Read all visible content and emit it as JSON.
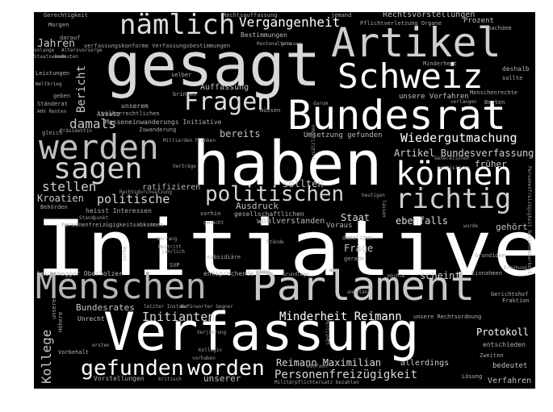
{
  "words": [
    {
      "text": "Initiative",
      "shade": "#ffffff"
    },
    {
      "text": "haben",
      "shade": "#ffffff"
    },
    {
      "text": "gesagt",
      "shade": "#d8d8d8"
    },
    {
      "text": "Verfassung",
      "shade": "#ffffff"
    },
    {
      "text": "Parlament",
      "shade": "#c8c8c8"
    },
    {
      "text": "Menschen",
      "shade": "#b5b5b5"
    },
    {
      "text": "Bundesrat",
      "shade": "#ffffff"
    },
    {
      "text": "Artikel",
      "shade": "#cfcfcf"
    },
    {
      "text": "Schweiz",
      "shade": "#ffffff"
    },
    {
      "text": "nämlich",
      "shade": "#dcdcdc"
    },
    {
      "text": "werden",
      "shade": "#c0c0c0"
    },
    {
      "text": "können",
      "shade": "#ffffff"
    },
    {
      "text": "sagen",
      "shade": "#d0d0d0"
    },
    {
      "text": "Fragen",
      "shade": "#dedede"
    },
    {
      "text": "richtig",
      "shade": "#d0d0d0"
    },
    {
      "text": "politischen",
      "shade": "#d4d4d4"
    },
    {
      "text": "gefunden",
      "shade": "#ffffff"
    },
    {
      "text": "worden",
      "shade": "#ffffff"
    },
    {
      "text": "Vergangenheit",
      "shade": "#ffffff"
    },
    {
      "text": "Wiedergutmachung",
      "shade": "#ffffff"
    },
    {
      "text": "Minderheit Reimann",
      "shade": "#ffffff"
    },
    {
      "text": "Personenfreizügigkeit",
      "shade": "#d8d8d8"
    },
    {
      "text": "Reimann Maximilian",
      "shade": "#d8d8d8"
    },
    {
      "text": "Initianten",
      "shade": "#d8d8d8"
    },
    {
      "text": "Kollege",
      "shade": "#c8c8c8"
    },
    {
      "text": "politische",
      "shade": "#d8d8d8"
    },
    {
      "text": "stellen",
      "shade": "#d0d0d0"
    },
    {
      "text": "damals",
      "shade": "#c8c8c8"
    },
    {
      "text": "Bericht",
      "shade": "#c8c8c8"
    },
    {
      "text": "Jahren",
      "shade": "#c8c8c8"
    },
    {
      "text": "Artikel Bundesverfassung",
      "shade": "#d0d0d0"
    },
    {
      "text": "früher",
      "shade": "#d0d0d0"
    },
    {
      "text": "bereits",
      "shade": "#c0c0c0"
    },
    {
      "text": "sollten",
      "shade": "#c8c8c8"
    },
    {
      "text": "ebenfalls",
      "shade": "#d8d8d8"
    },
    {
      "text": "Staat",
      "shade": "#d8d8d8"
    },
    {
      "text": "Frage",
      "shade": "#c8c8c8"
    },
    {
      "text": "scheint",
      "shade": "#d0d0d0"
    },
    {
      "text": "Protokoll",
      "shade": "#ffffff"
    },
    {
      "text": "allerdings",
      "shade": "#c8c8c8"
    },
    {
      "text": "Verfahren",
      "shade": "#c0c0c0"
    },
    {
      "text": "bedeutet",
      "shade": "#c0c0c0"
    },
    {
      "text": "Bundesrates",
      "shade": "#c8c8c8"
    },
    {
      "text": "Kroatien",
      "shade": "#c8c8c8"
    },
    {
      "text": "Auffassung",
      "shade": "#c0c0c0"
    },
    {
      "text": "unsere Vorfahren",
      "shade": "#c0c0c0"
    },
    {
      "text": "Rechtsvorstellungen",
      "shade": "#c0c0c0"
    },
    {
      "text": "Prozent",
      "shade": "#c0c0c0"
    },
    {
      "text": "Bestimmungen",
      "shade": "#b8b8b8"
    },
    {
      "text": "Leutenegger Oberholzer",
      "shade": "#b8b8b8"
    },
    {
      "text": "entsprechende",
      "shade": "#b0b0b0"
    },
    {
      "text": "gehört",
      "shade": "#c0c0c0"
    },
    {
      "text": "unserer",
      "shade": "#c0c0c0"
    },
    {
      "text": "Unrecht",
      "shade": "#c0c0c0"
    },
    {
      "text": "Absatz",
      "shade": "#b8b8b8"
    },
    {
      "text": "unserem",
      "shade": "#b8b8b8"
    },
    {
      "text": "Umsetzung gefunden",
      "shade": "#b8b8b8"
    },
    {
      "text": "Ausdruck",
      "shade": "#c0c0c0"
    },
    {
      "text": "ratifizieren",
      "shade": "#b8b8b8"
    },
    {
      "text": "gesellschaftlichen",
      "shade": "#b0b0b0"
    },
    {
      "text": "Voraus",
      "shade": "#b8b8b8"
    },
    {
      "text": "wohlverstanden",
      "shade": "#b8b8b8"
    },
    {
      "text": "Entscheidung",
      "shade": "#b0b0b0"
    },
    {
      "text": "Gerechtigkeit",
      "shade": "#b0b0b0"
    },
    {
      "text": "Rechtsauffassung",
      "shade": "#a8a8a8"
    },
    {
      "text": "jemand",
      "shade": "#a8a8a8"
    },
    {
      "text": "Pflichtverletzung Organe",
      "shade": "#a8a8a8"
    },
    {
      "text": "nachdem",
      "shade": "#a8a8a8"
    },
    {
      "text": "Morgen",
      "shade": "#b0b0b0"
    },
    {
      "text": "darauf",
      "shade": "#b0b0b0"
    },
    {
      "text": "verfassungskonforme Verfassungsbestimmungen",
      "shade": "#a8a8a8"
    },
    {
      "text": "solange",
      "shade": "#a8a8a8"
    },
    {
      "text": "Altersvorsorge",
      "shade": "#a8a8a8"
    },
    {
      "text": "Staatswesen",
      "shade": "#a0a0a0"
    },
    {
      "text": "bedeuten",
      "shade": "#a8a8a8"
    },
    {
      "text": "Rentenalters",
      "shade": "#a0a0a0"
    },
    {
      "text": "grossen",
      "shade": "#a0a0a0"
    },
    {
      "text": "Minderheit",
      "shade": "#a8a8a8"
    },
    {
      "text": "deshalb",
      "shade": "#b0b0b0"
    },
    {
      "text": "sollte",
      "shade": "#b0b0b0"
    },
    {
      "text": "Leistungen",
      "shade": "#b0b0b0"
    },
    {
      "text": "selber",
      "shade": "#b0b0b0"
    },
    {
      "text": "Weltkrieg",
      "shade": "#a8a8a8"
    },
    {
      "text": "geben",
      "shade": "#a8a8a8"
    },
    {
      "text": "bringen",
      "shade": "#a8a8a8"
    },
    {
      "text": "Menschenrechte",
      "shade": "#a8a8a8"
    },
    {
      "text": "Ständerat",
      "shade": "#b0b0b0"
    },
    {
      "text": "AHV Renten",
      "shade": "#a8a8a8"
    },
    {
      "text": "völkerrechtlichen",
      "shade": "#a8a8a8"
    },
    {
      "text": "Masseneinwanderungs Initiative",
      "shade": "#b0b0b0"
    },
    {
      "text": "müssen",
      "shade": "#a8a8a8"
    },
    {
      "text": "darum",
      "shade": "#a0a0a0"
    },
    {
      "text": "verlangen",
      "shade": "#a0a0a0"
    },
    {
      "text": "Besten",
      "shade": "#a8a8a8"
    },
    {
      "text": "gleich",
      "shade": "#a8a8a8"
    },
    {
      "text": "Präsidentin",
      "shade": "#a8a8a8"
    },
    {
      "text": "Zuwanderung",
      "shade": "#a8a8a8"
    },
    {
      "text": "Milliarden Franken",
      "shade": "#a0a0a0"
    },
    {
      "text": "Generationen",
      "shade": "#a0a0a0"
    },
    {
      "text": "kritisieren",
      "shade": "#a0a0a0"
    },
    {
      "text": "Verträge",
      "shade": "#a0a0a0"
    },
    {
      "text": "zusätzlichen",
      "shade": "#a0a0a0"
    },
    {
      "text": "Personenfreizügigkeit Gerichtsbarkeit",
      "shade": "#a0a0a0"
    },
    {
      "text": "Rechtsdurchsetzung",
      "shade": "#a0a0a0"
    },
    {
      "text": "heutigen",
      "shade": "#a0a0a0"
    },
    {
      "text": "lassen",
      "shade": "#a0a0a0"
    },
    {
      "text": "Behörden",
      "shade": "#a8a8a8"
    },
    {
      "text": "heisst Interessen",
      "shade": "#b0b0b0"
    },
    {
      "text": "vorhin",
      "shade": "#a8a8a8"
    },
    {
      "text": "Standpunkt",
      "shade": "#a0a0a0"
    },
    {
      "text": "Personenfreizügigkeitsabkommen",
      "shade": "#b0b0b0"
    },
    {
      "text": "gemacht",
      "shade": "#a8a8a8"
    },
    {
      "text": "wurde",
      "shade": "#a0a0a0"
    },
    {
      "text": "Vorrang",
      "shade": "#a0a0a0"
    },
    {
      "text": "Beitritt",
      "shade": "#a0a0a0"
    },
    {
      "text": "jährlich",
      "shade": "#a0a0a0"
    },
    {
      "text": "Stände",
      "shade": "#a0a0a0"
    },
    {
      "text": "damaligen",
      "shade": "#a8a8a8"
    },
    {
      "text": "Recht",
      "shade": "#a0a0a0"
    },
    {
      "text": "subsidiäre",
      "shade": "#a8a8a8"
    },
    {
      "text": "gerade",
      "shade": "#a8a8a8"
    },
    {
      "text": "Grundidee",
      "shade": "#a8a8a8"
    },
    {
      "text": "SVP",
      "shade": "#a8a8a8"
    },
    {
      "text": "Erhöhung",
      "shade": "#a0a0a0"
    },
    {
      "text": "Grundlage",
      "shade": "#a8a8a8"
    },
    {
      "text": "möchte",
      "shade": "#a8a8a8"
    },
    {
      "text": "Einnahmen",
      "shade": "#a8a8a8"
    },
    {
      "text": "angetan",
      "shade": "#a8a8a8"
    },
    {
      "text": "Fraktion",
      "shade": "#b0b0b0"
    },
    {
      "text": "Gerichtshof",
      "shade": "#b0b0b0"
    },
    {
      "text": "letzter Instanz",
      "shade": "#a0a0a0"
    },
    {
      "text": "Befürworter Gegner",
      "shade": "#a0a0a0"
    },
    {
      "text": "unsere",
      "shade": "#a8a8a8"
    },
    {
      "text": "Höhere",
      "shade": "#a8a8a8"
    },
    {
      "text": "unsere Rechtsordnung",
      "shade": "#b0b0b0"
    },
    {
      "text": "Vorbehalt",
      "shade": "#b0b0b0"
    },
    {
      "text": "Verjährung",
      "shade": "#a0a0a0"
    },
    {
      "text": "ersten",
      "shade": "#a8a8a8"
    },
    {
      "text": "Kollegin",
      "shade": "#a0a0a0"
    },
    {
      "text": "vorhaben",
      "shade": "#a0a0a0"
    },
    {
      "text": "einfach",
      "shade": "#a0a0a0"
    },
    {
      "text": "sämtliche",
      "shade": "#a0a0a0"
    },
    {
      "text": "entschieden",
      "shade": "#b0b0b0"
    },
    {
      "text": "Zweiten",
      "shade": "#a8a8a8"
    },
    {
      "text": "Vorstellungen",
      "shade": "#b0b0b0"
    },
    {
      "text": "kritisch",
      "shade": "#a0a0a0"
    },
    {
      "text": "Militärpflichtersatz bezahlen",
      "shade": "#a0a0a0"
    },
    {
      "text": "Lösung",
      "shade": "#b0b0b0"
    }
  ]
}
